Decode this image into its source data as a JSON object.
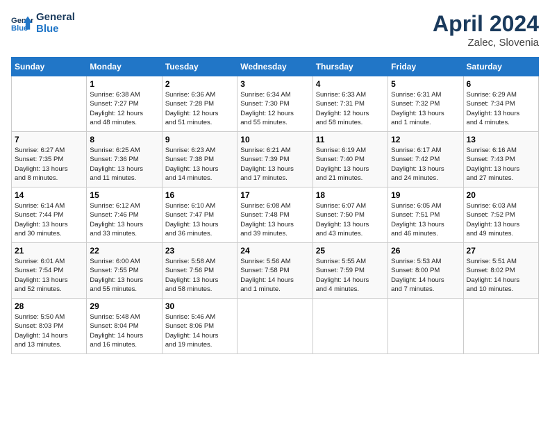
{
  "header": {
    "logo_line1": "General",
    "logo_line2": "Blue",
    "month_title": "April 2024",
    "subtitle": "Zalec, Slovenia"
  },
  "weekdays": [
    "Sunday",
    "Monday",
    "Tuesday",
    "Wednesday",
    "Thursday",
    "Friday",
    "Saturday"
  ],
  "weeks": [
    [
      {
        "day": "",
        "info": ""
      },
      {
        "day": "1",
        "info": "Sunrise: 6:38 AM\nSunset: 7:27 PM\nDaylight: 12 hours\nand 48 minutes."
      },
      {
        "day": "2",
        "info": "Sunrise: 6:36 AM\nSunset: 7:28 PM\nDaylight: 12 hours\nand 51 minutes."
      },
      {
        "day": "3",
        "info": "Sunrise: 6:34 AM\nSunset: 7:30 PM\nDaylight: 12 hours\nand 55 minutes."
      },
      {
        "day": "4",
        "info": "Sunrise: 6:33 AM\nSunset: 7:31 PM\nDaylight: 12 hours\nand 58 minutes."
      },
      {
        "day": "5",
        "info": "Sunrise: 6:31 AM\nSunset: 7:32 PM\nDaylight: 13 hours\nand 1 minute."
      },
      {
        "day": "6",
        "info": "Sunrise: 6:29 AM\nSunset: 7:34 PM\nDaylight: 13 hours\nand 4 minutes."
      }
    ],
    [
      {
        "day": "7",
        "info": "Sunrise: 6:27 AM\nSunset: 7:35 PM\nDaylight: 13 hours\nand 8 minutes."
      },
      {
        "day": "8",
        "info": "Sunrise: 6:25 AM\nSunset: 7:36 PM\nDaylight: 13 hours\nand 11 minutes."
      },
      {
        "day": "9",
        "info": "Sunrise: 6:23 AM\nSunset: 7:38 PM\nDaylight: 13 hours\nand 14 minutes."
      },
      {
        "day": "10",
        "info": "Sunrise: 6:21 AM\nSunset: 7:39 PM\nDaylight: 13 hours\nand 17 minutes."
      },
      {
        "day": "11",
        "info": "Sunrise: 6:19 AM\nSunset: 7:40 PM\nDaylight: 13 hours\nand 21 minutes."
      },
      {
        "day": "12",
        "info": "Sunrise: 6:17 AM\nSunset: 7:42 PM\nDaylight: 13 hours\nand 24 minutes."
      },
      {
        "day": "13",
        "info": "Sunrise: 6:16 AM\nSunset: 7:43 PM\nDaylight: 13 hours\nand 27 minutes."
      }
    ],
    [
      {
        "day": "14",
        "info": "Sunrise: 6:14 AM\nSunset: 7:44 PM\nDaylight: 13 hours\nand 30 minutes."
      },
      {
        "day": "15",
        "info": "Sunrise: 6:12 AM\nSunset: 7:46 PM\nDaylight: 13 hours\nand 33 minutes."
      },
      {
        "day": "16",
        "info": "Sunrise: 6:10 AM\nSunset: 7:47 PM\nDaylight: 13 hours\nand 36 minutes."
      },
      {
        "day": "17",
        "info": "Sunrise: 6:08 AM\nSunset: 7:48 PM\nDaylight: 13 hours\nand 39 minutes."
      },
      {
        "day": "18",
        "info": "Sunrise: 6:07 AM\nSunset: 7:50 PM\nDaylight: 13 hours\nand 43 minutes."
      },
      {
        "day": "19",
        "info": "Sunrise: 6:05 AM\nSunset: 7:51 PM\nDaylight: 13 hours\nand 46 minutes."
      },
      {
        "day": "20",
        "info": "Sunrise: 6:03 AM\nSunset: 7:52 PM\nDaylight: 13 hours\nand 49 minutes."
      }
    ],
    [
      {
        "day": "21",
        "info": "Sunrise: 6:01 AM\nSunset: 7:54 PM\nDaylight: 13 hours\nand 52 minutes."
      },
      {
        "day": "22",
        "info": "Sunrise: 6:00 AM\nSunset: 7:55 PM\nDaylight: 13 hours\nand 55 minutes."
      },
      {
        "day": "23",
        "info": "Sunrise: 5:58 AM\nSunset: 7:56 PM\nDaylight: 13 hours\nand 58 minutes."
      },
      {
        "day": "24",
        "info": "Sunrise: 5:56 AM\nSunset: 7:58 PM\nDaylight: 14 hours\nand 1 minute."
      },
      {
        "day": "25",
        "info": "Sunrise: 5:55 AM\nSunset: 7:59 PM\nDaylight: 14 hours\nand 4 minutes."
      },
      {
        "day": "26",
        "info": "Sunrise: 5:53 AM\nSunset: 8:00 PM\nDaylight: 14 hours\nand 7 minutes."
      },
      {
        "day": "27",
        "info": "Sunrise: 5:51 AM\nSunset: 8:02 PM\nDaylight: 14 hours\nand 10 minutes."
      }
    ],
    [
      {
        "day": "28",
        "info": "Sunrise: 5:50 AM\nSunset: 8:03 PM\nDaylight: 14 hours\nand 13 minutes."
      },
      {
        "day": "29",
        "info": "Sunrise: 5:48 AM\nSunset: 8:04 PM\nDaylight: 14 hours\nand 16 minutes."
      },
      {
        "day": "30",
        "info": "Sunrise: 5:46 AM\nSunset: 8:06 PM\nDaylight: 14 hours\nand 19 minutes."
      },
      {
        "day": "",
        "info": ""
      },
      {
        "day": "",
        "info": ""
      },
      {
        "day": "",
        "info": ""
      },
      {
        "day": "",
        "info": ""
      }
    ]
  ]
}
